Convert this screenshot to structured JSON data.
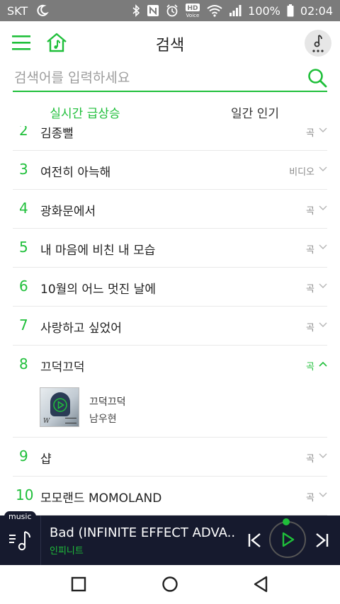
{
  "status_bar": {
    "carrier": "SKT",
    "battery": "100%",
    "time": "02:04",
    "hd_voice": "HD"
  },
  "header": {
    "title": "검색",
    "icons": [
      "hamburger-menu-icon",
      "home-music-icon",
      "music-note-icon"
    ]
  },
  "search": {
    "placeholder": "검색어를 입력하세요"
  },
  "tabs": [
    {
      "label": "실시간 급상승",
      "active": true
    },
    {
      "label": "일간 인기",
      "active": false
    }
  ],
  "list": {
    "items": [
      {
        "rank": "2",
        "title": "김종뻘",
        "type": "곡"
      },
      {
        "rank": "3",
        "title": "여전히 아늑해",
        "type": "비디오"
      },
      {
        "rank": "4",
        "title": "광화문에서",
        "type": "곡"
      },
      {
        "rank": "5",
        "title": "내 마음에 비친 내 모습",
        "type": "곡"
      },
      {
        "rank": "6",
        "title": "10월의 어느 멋진 날에",
        "type": "곡"
      },
      {
        "rank": "7",
        "title": "사랑하고 싶었어",
        "type": "곡"
      },
      {
        "rank": "8",
        "title": "끄덕끄덕",
        "type": "곡"
      },
      {
        "rank": "9",
        "title": "샵",
        "type": "곡"
      },
      {
        "rank": "10",
        "title": "모모랜드 MOMOLAND",
        "type": "곡"
      }
    ],
    "expanded": {
      "song": "끄덕끄덕",
      "artist": "남우현",
      "album_letter": "W"
    }
  },
  "player": {
    "tag": "music",
    "now_title": "Bad (INFINITE EFFECT ADVA...",
    "now_artist": "인피니트"
  },
  "colors": {
    "accent": "#1fbf3a",
    "status_bar": "#7b7b7b",
    "player_bg": "#161a2e"
  }
}
